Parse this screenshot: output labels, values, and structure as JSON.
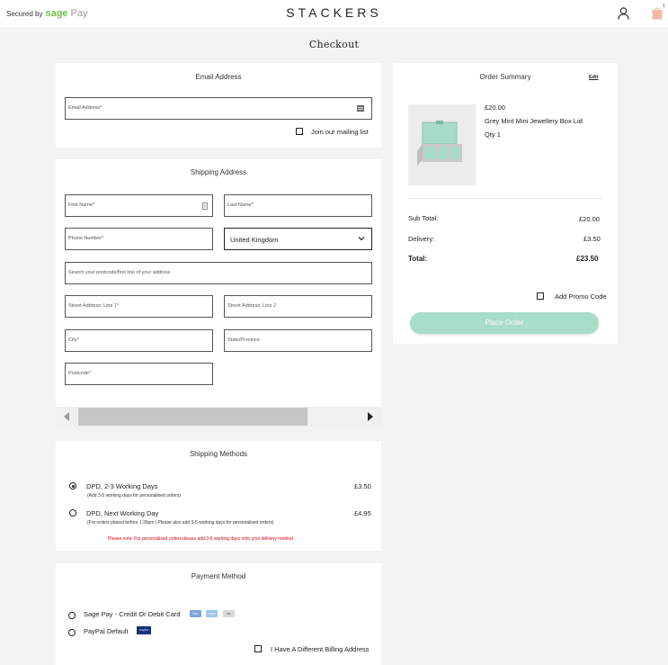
{
  "header": {
    "secured_by": "Secured by",
    "sage": "sage",
    "pay": "Pay",
    "brand": "STACKERS",
    "bag_count": "1"
  },
  "page": {
    "title": "Checkout"
  },
  "email_section": {
    "title": "Email Address",
    "email_placeholder": "Email Address*",
    "mailing_list_label": "Join our mailing list",
    "mailing_list_checked": false
  },
  "shipping_address": {
    "title": "Shipping Address",
    "first_name": "First Name*",
    "last_name": "Last Name*",
    "phone": "Phone Number*",
    "country": "United Kingdom",
    "postcode_search": "Search your postcode/first line of your address",
    "street1": "Street Address: Line 1*",
    "street2": "Street Address: Line 2",
    "city": "City*",
    "state": "State/Province",
    "postcode": "Postcode*"
  },
  "shipping_methods": {
    "title": "Shipping Methods",
    "options": [
      {
        "label": "DPD, 2-3 Working Days",
        "note": "(Add 3-5 working days for personalised orders)",
        "price": "£3.50",
        "selected": true
      },
      {
        "label": "DPD, Next Working Day",
        "note": "(For orders placed before 1:30pm | Please also add 3-5 working days for personalised orders)",
        "price": "£4.95",
        "selected": false
      }
    ],
    "warning": "Please note: For personalised orders please add 3-5 working days onto your delivery method"
  },
  "payment": {
    "title": "Payment Method",
    "options": [
      {
        "label": "Sage Pay - Credit Or Debit Card"
      },
      {
        "label": "PayPal Default",
        "badge": "PayPal"
      }
    ],
    "card_labels": [
      "VISA",
      "AMEX",
      "MC"
    ],
    "billing_label": "I Have A Different Billing Address"
  },
  "summary": {
    "title": "Order Summary",
    "edit": "Edit",
    "item_price": "£20.00",
    "item_name": "Grey Mint Mini Jewellery Box Lid",
    "item_qty": "Qty 1",
    "subtotal_label": "Sub Total:",
    "subtotal": "£20.00",
    "delivery_label": "Delivery:",
    "delivery": "£3.50",
    "total_label": "Total:",
    "total": "£23.50",
    "promo_label": "Add Promo Code",
    "place_order": "Place Order"
  },
  "colors": {
    "accent_mint": "#a8ddc7",
    "sage_green": "#6fc44a",
    "warning_red": "#d0021b",
    "bag_peach": "#f4b9a3"
  }
}
